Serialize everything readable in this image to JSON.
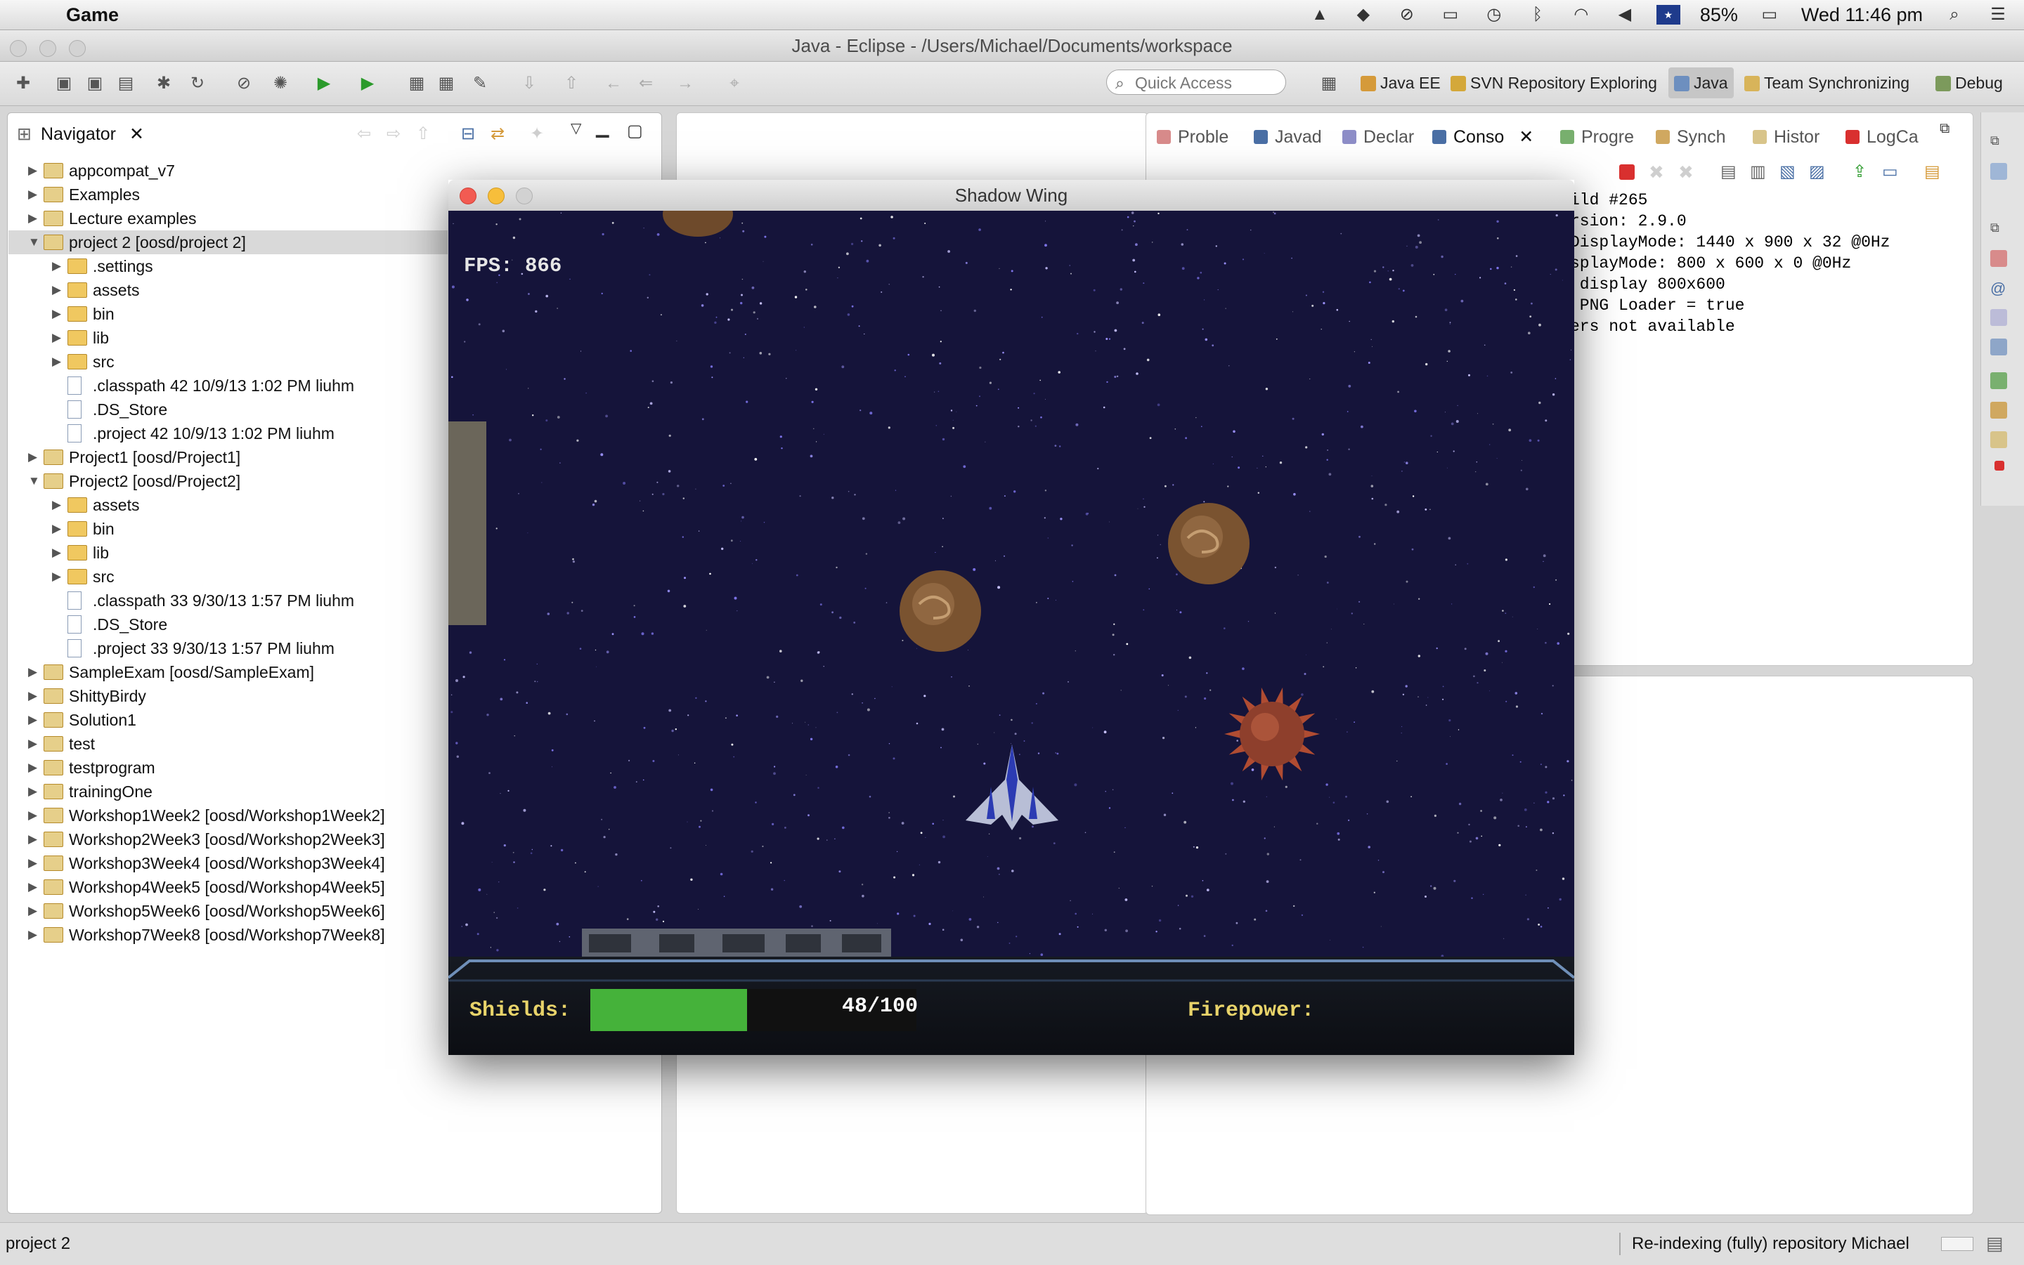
{
  "menubar": {
    "app_name": "Game",
    "battery": "85%",
    "clock": "Wed 11:46 pm"
  },
  "eclipse": {
    "title": "Java - Eclipse - /Users/Michael/Documents/workspace",
    "quick_access_placeholder": "Quick Access",
    "perspectives": [
      "Java EE",
      "SVN Repository Exploring",
      "Java",
      "Team Synchronizing",
      "Debug"
    ]
  },
  "navigator": {
    "tab_label": "Navigator",
    "items": [
      {
        "label": "appcompat_v7",
        "depth": 0,
        "kind": "project",
        "expanded": false
      },
      {
        "label": "Examples",
        "depth": 0,
        "kind": "project",
        "expanded": false
      },
      {
        "label": "Lecture examples",
        "depth": 0,
        "kind": "project",
        "expanded": false
      },
      {
        "label": "project 2 [oosd/project 2]",
        "depth": 0,
        "kind": "project",
        "expanded": true,
        "selected": true
      },
      {
        "label": ".settings",
        "depth": 1,
        "kind": "folder",
        "expanded": false
      },
      {
        "label": "assets",
        "depth": 1,
        "kind": "folder",
        "expanded": false
      },
      {
        "label": "bin",
        "depth": 1,
        "kind": "folder",
        "expanded": false
      },
      {
        "label": "lib",
        "depth": 1,
        "kind": "folder",
        "expanded": false
      },
      {
        "label": "src",
        "depth": 1,
        "kind": "folder",
        "expanded": false
      },
      {
        "label": ".classpath 42  10/9/13 1:02 PM  liuhm",
        "depth": 1,
        "kind": "file"
      },
      {
        "label": ".DS_Store",
        "depth": 1,
        "kind": "file"
      },
      {
        "label": ".project 42  10/9/13 1:02 PM  liuhm",
        "depth": 1,
        "kind": "file"
      },
      {
        "label": "Project1 [oosd/Project1]",
        "depth": 0,
        "kind": "project",
        "expanded": false
      },
      {
        "label": "Project2 [oosd/Project2]",
        "depth": 0,
        "kind": "project",
        "expanded": true
      },
      {
        "label": "assets",
        "depth": 1,
        "kind": "folder",
        "expanded": false
      },
      {
        "label": "bin",
        "depth": 1,
        "kind": "folder",
        "expanded": false
      },
      {
        "label": "lib",
        "depth": 1,
        "kind": "folder",
        "expanded": false
      },
      {
        "label": "src",
        "depth": 1,
        "kind": "folder",
        "expanded": false
      },
      {
        "label": ".classpath 33  9/30/13 1:57 PM  liuhm",
        "depth": 1,
        "kind": "file"
      },
      {
        "label": ".DS_Store",
        "depth": 1,
        "kind": "file"
      },
      {
        "label": ".project 33  9/30/13 1:57 PM  liuhm",
        "depth": 1,
        "kind": "file"
      },
      {
        "label": "SampleExam [oosd/SampleExam]",
        "depth": 0,
        "kind": "project",
        "expanded": false
      },
      {
        "label": "ShittyBirdy",
        "depth": 0,
        "kind": "project",
        "expanded": false
      },
      {
        "label": "Solution1",
        "depth": 0,
        "kind": "project",
        "expanded": false
      },
      {
        "label": "test",
        "depth": 0,
        "kind": "project",
        "expanded": false
      },
      {
        "label": "testprogram",
        "depth": 0,
        "kind": "project",
        "expanded": false
      },
      {
        "label": "trainingOne",
        "depth": 0,
        "kind": "project",
        "expanded": false
      },
      {
        "label": "Workshop1Week2 [oosd/Workshop1Week2]",
        "depth": 0,
        "kind": "project",
        "expanded": false
      },
      {
        "label": "Workshop2Week3 [oosd/Workshop2Week3]",
        "depth": 0,
        "kind": "project",
        "expanded": false
      },
      {
        "label": "Workshop3Week4 [oosd/Workshop3Week4]",
        "depth": 0,
        "kind": "project",
        "expanded": false
      },
      {
        "label": "Workshop4Week5 [oosd/Workshop4Week5]",
        "depth": 0,
        "kind": "project",
        "expanded": false
      },
      {
        "label": "Workshop5Week6 [oosd/Workshop5Week6]",
        "depth": 0,
        "kind": "project",
        "expanded": false
      },
      {
        "label": "Workshop7Week8 [oosd/Workshop7Week8]",
        "depth": 0,
        "kind": "project",
        "expanded": false
      }
    ]
  },
  "console_tabs": [
    "Proble",
    "Javad",
    "Declar",
    "Conso",
    "Progre",
    "Synch",
    "Histor",
    "LogCa"
  ],
  "console_lines": [
    "ild #265",
    "rsion: 2.9.0",
    "DisplayMode: 1440 x 900 x 32 @0Hz",
    "splayMode: 800 x 600 x 0 @0Hz",
    " display 800x600",
    " PNG Loader = true",
    "ers not available"
  ],
  "status": {
    "left": "project 2",
    "right": "Re-indexing (fully) repository Michael"
  },
  "game": {
    "window_title": "Shadow Wing",
    "fps_label": "FPS: 866",
    "shields_label": "Shields:",
    "shields_text": "48/100",
    "shields_fraction": 0.48,
    "firepower_label": "Firepower:",
    "colors": {
      "shield_bar": "#45b23a",
      "hud_label": "#e8d36a",
      "space": "#15143a"
    }
  }
}
